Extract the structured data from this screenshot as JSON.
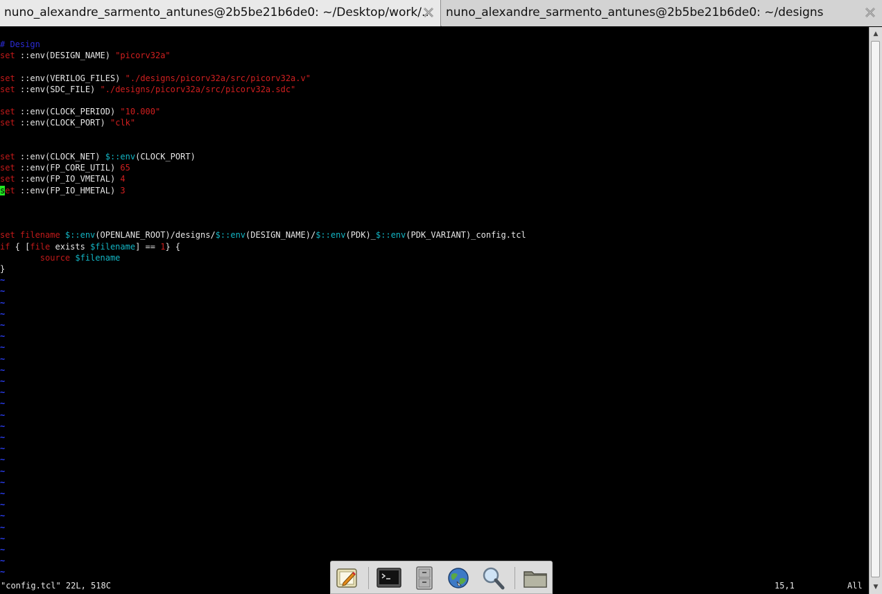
{
  "tabs": [
    {
      "title": "nuno_alexandre_sarmento_antunes@2b5be21b6de0: ~/Desktop/work/...",
      "active": true
    },
    {
      "title": "nuno_alexandre_sarmento_antunes@2b5be21b6de0: ~/designs",
      "active": false
    }
  ],
  "editor": {
    "lines": [
      [
        {
          "t": "# Design",
          "c": "cmt"
        }
      ],
      [
        {
          "t": "set",
          "c": "kw"
        },
        {
          "t": " ::env(DESIGN_NAME) ",
          "c": "txt"
        },
        {
          "t": "\"picorv32a\"",
          "c": "str"
        }
      ],
      [],
      [
        {
          "t": "set",
          "c": "kw"
        },
        {
          "t": " ::env(VERILOG_FILES) ",
          "c": "txt"
        },
        {
          "t": "\"./designs/picorv32a/src/picorv32a.v\"",
          "c": "str"
        }
      ],
      [
        {
          "t": "set",
          "c": "kw"
        },
        {
          "t": " ::env(SDC_FILE) ",
          "c": "txt"
        },
        {
          "t": "\"./designs/picorv32a/src/picorv32a.sdc\"",
          "c": "str"
        }
      ],
      [],
      [
        {
          "t": "set",
          "c": "kw"
        },
        {
          "t": " ::env(CLOCK_PERIOD) ",
          "c": "txt"
        },
        {
          "t": "\"10.000\"",
          "c": "str"
        }
      ],
      [
        {
          "t": "set",
          "c": "kw"
        },
        {
          "t": " ::env(CLOCK_PORT) ",
          "c": "txt"
        },
        {
          "t": "\"clk\"",
          "c": "str"
        }
      ],
      [],
      [],
      [
        {
          "t": "set",
          "c": "kw"
        },
        {
          "t": " ::env(CLOCK_NET) ",
          "c": "txt"
        },
        {
          "t": "$::env",
          "c": "var"
        },
        {
          "t": "(CLOCK_PORT)",
          "c": "txt"
        }
      ],
      [
        {
          "t": "set",
          "c": "kw"
        },
        {
          "t": " ::env(FP_CORE_UTIL) ",
          "c": "txt"
        },
        {
          "t": "65",
          "c": "num"
        }
      ],
      [
        {
          "t": "set",
          "c": "kw"
        },
        {
          "t": " ::env(FP_IO_VMETAL) ",
          "c": "txt"
        },
        {
          "t": "4",
          "c": "num"
        }
      ],
      [
        {
          "t": "s",
          "c": "cursor"
        },
        {
          "t": "et",
          "c": "kw"
        },
        {
          "t": " ::env(FP_IO_HMETAL) ",
          "c": "txt"
        },
        {
          "t": "3",
          "c": "num"
        }
      ],
      [],
      [],
      [],
      [
        {
          "t": "set filename ",
          "c": "kw"
        },
        {
          "t": "$::env",
          "c": "var"
        },
        {
          "t": "(OPENLANE_ROOT)/designs/",
          "c": "txt"
        },
        {
          "t": "$::env",
          "c": "var"
        },
        {
          "t": "(DESIGN_NAME)/",
          "c": "txt"
        },
        {
          "t": "$::env",
          "c": "var"
        },
        {
          "t": "(PDK)_",
          "c": "txt"
        },
        {
          "t": "$::env",
          "c": "var"
        },
        {
          "t": "(PDK_VARIANT)_config.tcl",
          "c": "txt"
        }
      ],
      [
        {
          "t": "if",
          "c": "kw"
        },
        {
          "t": " { [",
          "c": "txt"
        },
        {
          "t": "file",
          "c": "kw"
        },
        {
          "t": " exists ",
          "c": "txt"
        },
        {
          "t": "$filename",
          "c": "var"
        },
        {
          "t": "] == ",
          "c": "txt"
        },
        {
          "t": "1",
          "c": "num"
        },
        {
          "t": "} {",
          "c": "txt"
        }
      ],
      [
        {
          "t": "        source ",
          "c": "kw"
        },
        {
          "t": "$filename",
          "c": "var"
        }
      ],
      [
        {
          "t": "}",
          "c": "txt"
        }
      ]
    ],
    "tilde": "~",
    "tilde_count": 27
  },
  "status": {
    "file_info": "\"config.tcl\" 22L, 518C",
    "position": "15,1",
    "scroll": "All"
  },
  "dock": {
    "items": [
      "text-editor-icon",
      "terminal-icon",
      "file-cabinet-icon",
      "web-browser-icon",
      "search-icon",
      "folder-icon"
    ]
  },
  "colors": {
    "keyword": "#c21a1a",
    "string": "#d11f1f",
    "variable": "#13b5c4",
    "comment": "#2b2bd6",
    "cursor": "#22e622",
    "tilde": "#2a3df0"
  }
}
